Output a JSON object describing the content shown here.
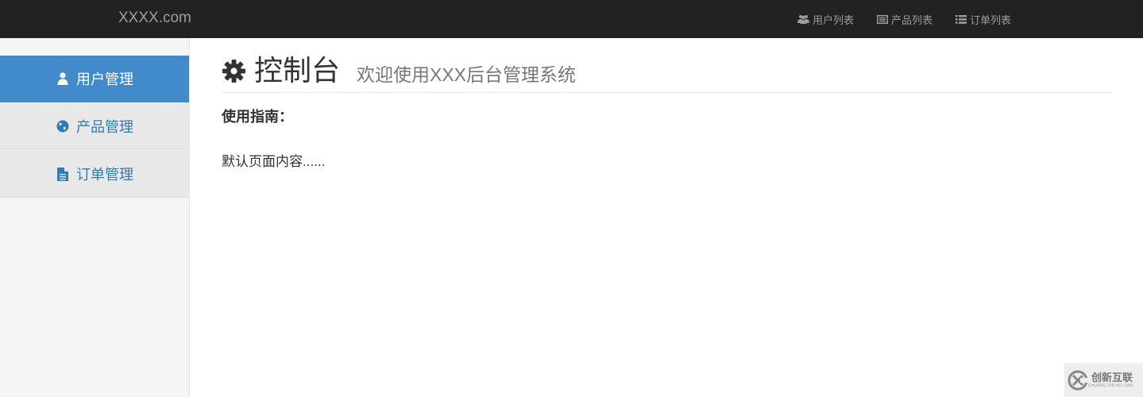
{
  "navbar": {
    "brand": "XXXX.com",
    "links": [
      {
        "label": "用户列表",
        "icon": "users-icon"
      },
      {
        "label": "产品列表",
        "icon": "list-alt-icon"
      },
      {
        "label": "订单列表",
        "icon": "list-icon"
      }
    ]
  },
  "sidebar": {
    "items": [
      {
        "label": "用户管理",
        "icon": "user-icon",
        "active": true
      },
      {
        "label": "产品管理",
        "icon": "globe-icon",
        "active": false
      },
      {
        "label": "订单管理",
        "icon": "file-icon",
        "active": false
      }
    ]
  },
  "main": {
    "title": "控制台",
    "title_icon": "gear-icon",
    "subtitle": "欢迎使用XXX后台管理系统",
    "guide_title": "使用指南：",
    "default_content": "默认页面内容......"
  },
  "watermark": {
    "text": "创新互联",
    "sub": "CHUANG XIN HU LIAN"
  },
  "colors": {
    "navbar_bg": "#222222",
    "active_item": "#428bca",
    "link": "#337ab7"
  }
}
